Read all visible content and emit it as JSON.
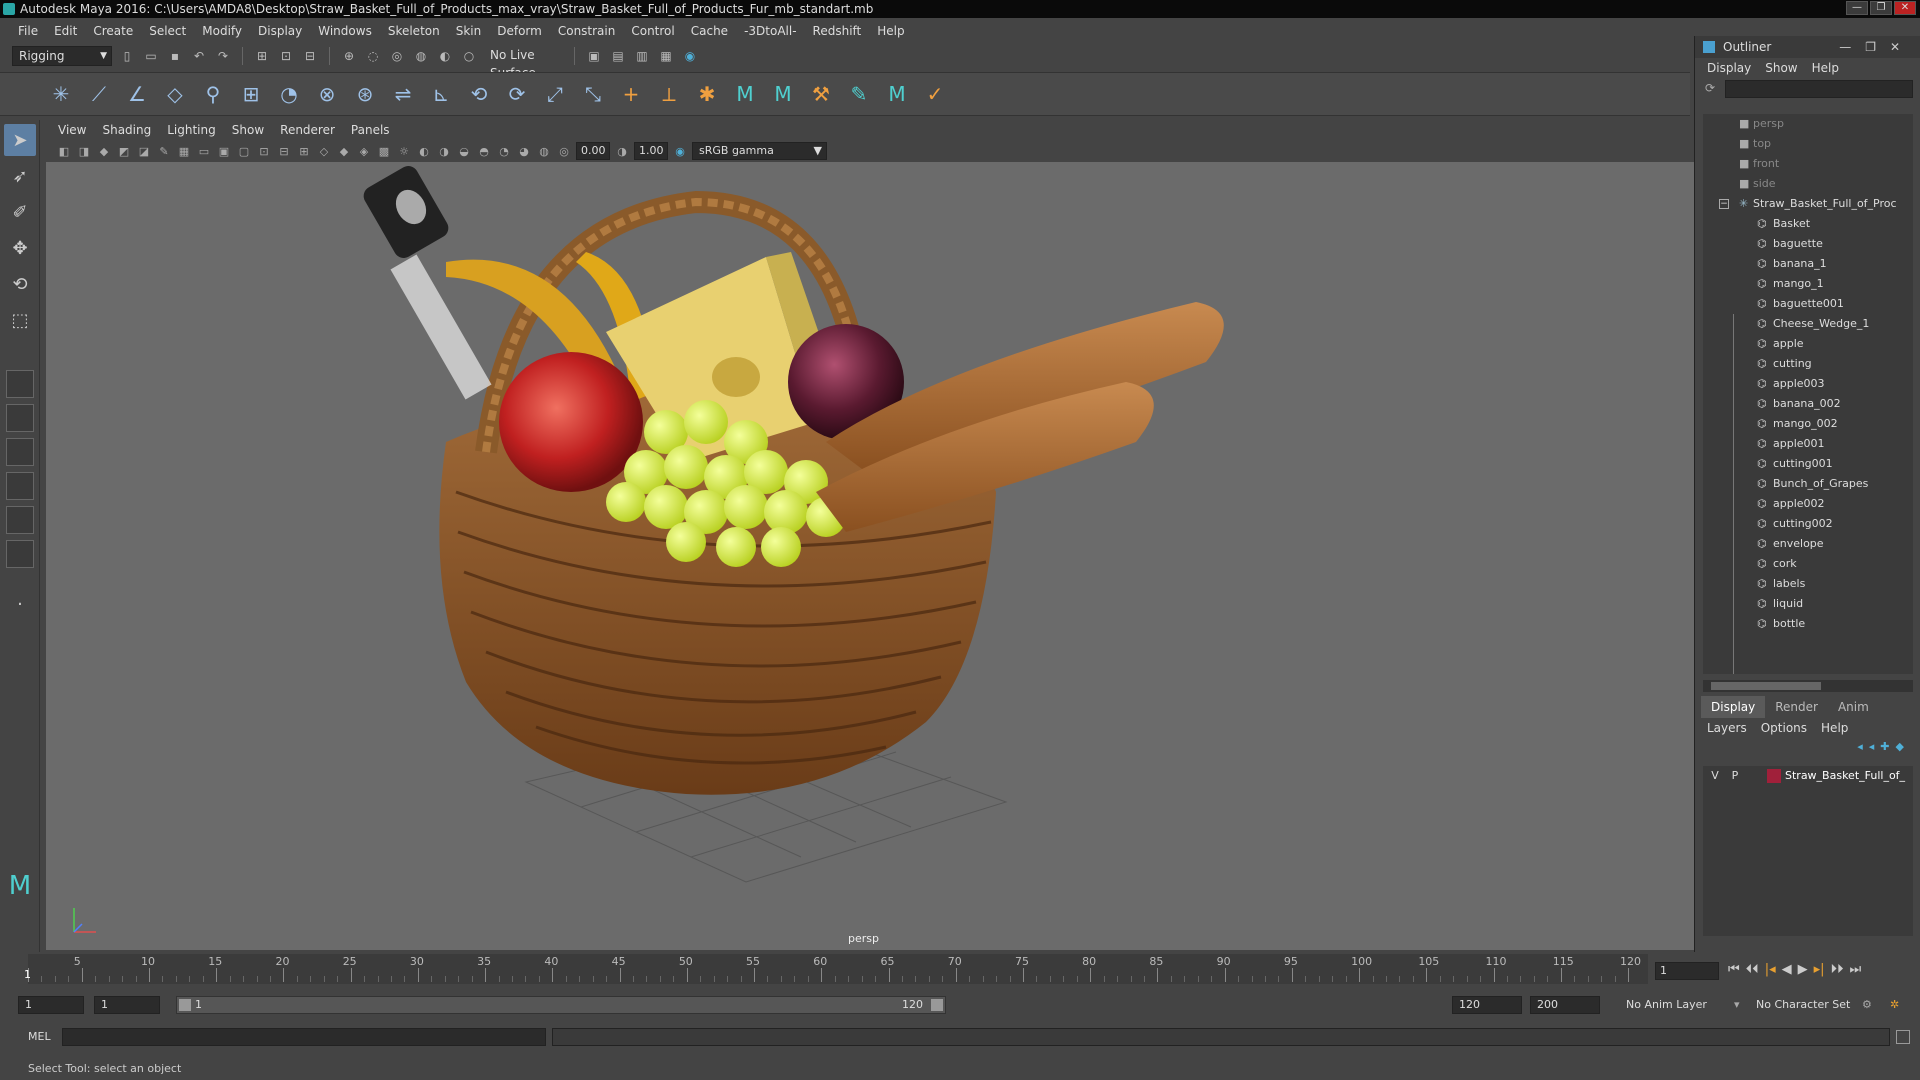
{
  "window": {
    "title": "Autodesk Maya 2016: C:\\Users\\AMDA8\\Desktop\\Straw_Basket_Full_of_Products_max_vray\\Straw_Basket_Full_of_Products_Fur_mb_standart.mb",
    "buttons": [
      "—",
      "❐",
      "✕"
    ]
  },
  "menubar": [
    "File",
    "Edit",
    "Create",
    "Select",
    "Modify",
    "Display",
    "Windows",
    "Skeleton",
    "Skin",
    "Deform",
    "Constrain",
    "Control",
    "Cache",
    "-3DtoAll-",
    "Redshift",
    "Help"
  ],
  "statusline": {
    "mode": "Rigging",
    "live_surface": "No Live Surface"
  },
  "panel_menu": [
    "View",
    "Shading",
    "Lighting",
    "Show",
    "Renderer",
    "Panels"
  ],
  "panel_tools": {
    "exposure": "0.00",
    "gamma_value": "1.00",
    "color_space": "sRGB gamma"
  },
  "viewport": {
    "camera_label": "persp",
    "background": "#6b6b6b"
  },
  "outliner": {
    "title": "Outliner",
    "menu": [
      "Display",
      "Show",
      "Help"
    ],
    "cameras": [
      "persp",
      "top",
      "front",
      "side"
    ],
    "root": "Straw_Basket_Full_of_Proc",
    "children": [
      "Basket",
      "baguette",
      "banana_1",
      "mango_1",
      "baguette001",
      "Cheese_Wedge_1",
      "apple",
      "cutting",
      "apple003",
      "banana_002",
      "mango_002",
      "apple001",
      "cutting001",
      "Bunch_of_Grapes",
      "apple002",
      "cutting002",
      "envelope",
      "cork",
      "labels",
      "liquid",
      "bottle"
    ]
  },
  "layers": {
    "tabs": [
      "Display",
      "Render",
      "Anim"
    ],
    "active_tab": "Display",
    "menu": [
      "Layers",
      "Options",
      "Help"
    ],
    "rows": [
      {
        "v": "V",
        "p": "P",
        "name": "Straw_Basket_Full_of_",
        "color": "#a0203a"
      }
    ]
  },
  "timeline": {
    "labels": [
      "1",
      "5",
      "10",
      "15",
      "20",
      "25",
      "30",
      "35",
      "40",
      "45",
      "50",
      "55",
      "60",
      "65",
      "70",
      "75",
      "80",
      "85",
      "90",
      "95",
      "100",
      "105",
      "110",
      "115",
      "120"
    ],
    "current_frame": "1"
  },
  "range": {
    "start": "1",
    "playback_start": "1",
    "slider_low": "1",
    "slider_high": "120",
    "playback_end": "120",
    "end": "200",
    "anim_layer": "No Anim Layer",
    "character_set": "No Character Set"
  },
  "command": {
    "mel_label": "MEL"
  },
  "helpline": {
    "text": "Select Tool: select an object"
  }
}
